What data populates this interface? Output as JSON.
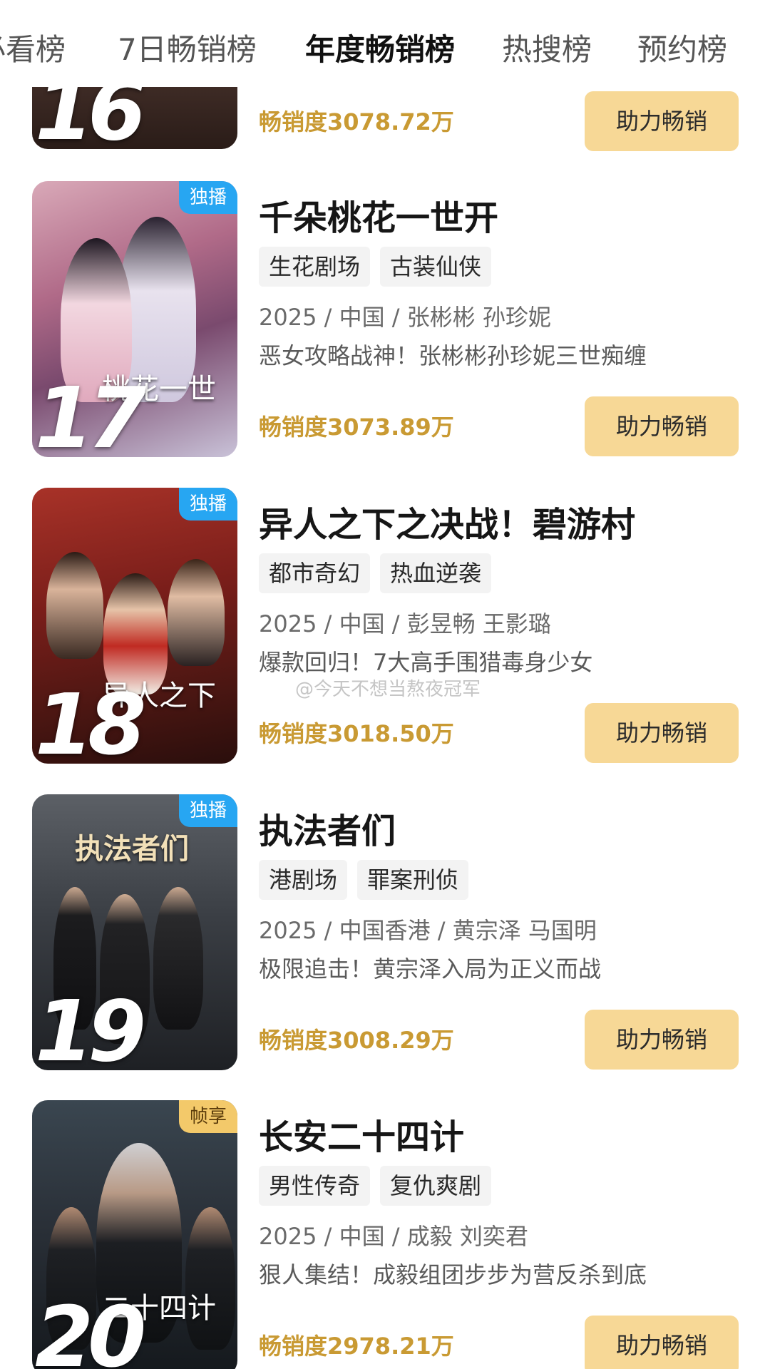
{
  "tabs": [
    {
      "label": "必看榜",
      "active": false
    },
    {
      "label": "7日畅销榜",
      "active": false
    },
    {
      "label": "年度畅销榜",
      "active": true
    },
    {
      "label": "热搜榜",
      "active": false
    },
    {
      "label": "预约榜",
      "active": false
    }
  ],
  "boost_label": "助力畅销",
  "items": [
    {
      "rank": "16",
      "sales": "畅销度3078.72万"
    },
    {
      "rank": "17",
      "badge": "独播",
      "title": "千朵桃花一世开",
      "tags": [
        "生花剧场",
        "古装仙侠"
      ],
      "meta": "2025 / 中国 / 张彬彬 孙珍妮",
      "desc": "恶女攻略战神！张彬彬孙珍妮三世痴缠",
      "sales": "畅销度3073.89万"
    },
    {
      "rank": "18",
      "badge": "独播",
      "title": "异人之下之决战！碧游村",
      "tags": [
        "都市奇幻",
        "热血逆袭"
      ],
      "meta": "2025 / 中国 / 彭昱畅 王影璐",
      "desc": "爆款回归！7大高手围猎毒身少女",
      "sales": "畅销度3018.50万"
    },
    {
      "rank": "19",
      "badge": "独播",
      "title": "执法者们",
      "tags": [
        "港剧场",
        "罪案刑侦"
      ],
      "meta": "2025 / 中国香港 / 黄宗泽 马国明",
      "desc": "极限追击！黄宗泽入局为正义而战",
      "sales": "畅销度3008.29万"
    },
    {
      "rank": "20",
      "badge": "帧享",
      "title": "长安二十四计",
      "tags": [
        "男性传奇",
        "复仇爽剧"
      ],
      "meta": "2025 / 中国 / 成毅 刘奕君",
      "desc": "狠人集结！成毅组团步步为营反杀到底",
      "sales": "畅销度2978.21万"
    }
  ],
  "watermark": "@今天不想当熬夜冠军",
  "colors": {
    "accent_gold": "#c99a33",
    "button_bg": "#f7d896",
    "badge_blue": "#27a6f2",
    "badge_gold": "#f3c96a"
  }
}
